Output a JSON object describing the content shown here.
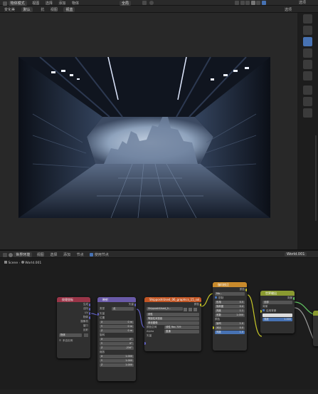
{
  "colors": {
    "header_bg": "#2a2a2a",
    "viewport_bg": "#282828",
    "node_editor_bg": "#1d1d1d",
    "node_texcoord": "#9a3548",
    "node_mapping": "#6a5aa8",
    "node_image": "#c15524",
    "node_color": "#c88a2c",
    "node_output": "#8a9a30",
    "active_tool": "#4772b3"
  },
  "top_header": {
    "editor_icon": "3d-viewport-icon",
    "object_mode": "物体模式",
    "menus": [
      "视图",
      "选择",
      "添加",
      "物体"
    ],
    "transform_orientation": "全局",
    "options_label": "选项"
  },
  "sub_header": {
    "transform_label": "变化美",
    "mode_label": "默认",
    "pivot_label": "抗",
    "mode2_label": "视图",
    "snap_label": "视蓝",
    "options_label": "选项"
  },
  "right_tools": [
    "cursor-icon",
    "select-icon",
    "move-icon",
    "rotate-icon",
    "scale-icon",
    "transform-icon",
    "annotate-icon",
    "measure-icon",
    "add-cube-icon"
  ],
  "node_header": {
    "editor_icon": "node-editor-icon",
    "object_type_label": "世界环境",
    "menus": [
      "视图",
      "选择",
      "添加",
      "节点"
    ],
    "use_nodes_label": "使用节点",
    "world_label": "World.001"
  },
  "breadcrumb": {
    "scene": "Scene",
    "world": "World.001"
  },
  "nodes": {
    "texcoord": {
      "title": "纹理坐标",
      "outputs": [
        "生成",
        "法向",
        "UV",
        "物体",
        "摄像机",
        "窗口",
        "反射"
      ],
      "object_label": "物体",
      "from_instancer": "来自实例"
    },
    "mapping": {
      "title": "映射",
      "type_label": "类型",
      "type_value": "点",
      "vector_label": "矢量",
      "location_label": "位置",
      "location": [
        "0 m",
        "0 m",
        "0 m"
      ],
      "rotation_label": "旋转",
      "rotation": [
        "0°",
        "0°",
        "-234°"
      ],
      "scale_label": "缩放",
      "scale": [
        "1.000",
        "1.000",
        "1.000"
      ],
      "output_label": "矢量"
    },
    "image": {
      "title": "ShipposhiUsed_06_graphics_15_sol...001",
      "color_out": "颜色",
      "image_name": "ShipposhiUsed_0...",
      "interp": "线性",
      "proj": "等距柱状投影",
      "source_label": "单张图像",
      "colorspace_label": "颜色空间",
      "colorspace_value": "线性 Rec.709",
      "alpha_label": "Alpha",
      "alpha_value": "直通",
      "vector_in": "矢量"
    },
    "color_adjust": {
      "title": "伽玛校正",
      "out_label": "颜色",
      "mode_value": "Ma...",
      "clamp_label": "钳制",
      "fields": [
        {
          "label": "色相",
          "value": "0.5"
        },
        {
          "label": "饱和度",
          "value": "0.4"
        },
        {
          "label": "亮度",
          "value": "1.1"
        },
        {
          "label": "系数",
          "value": "1.000"
        },
        {
          "label": "颜色",
          "value": ""
        }
      ],
      "fields2": [
        {
          "label": "伽玛",
          "value": "1.0"
        },
        {
          "label": "对比",
          "value": "0.0"
        },
        {
          "label": "亮度",
          "value": "1.0"
        }
      ]
    },
    "output": {
      "title": "世界输出",
      "out_label": "背景",
      "mode_value": "全部",
      "bg_label": "背景",
      "strength_label": "强度",
      "strength_value": "1.000",
      "checkbox_label": "启用背景"
    }
  }
}
